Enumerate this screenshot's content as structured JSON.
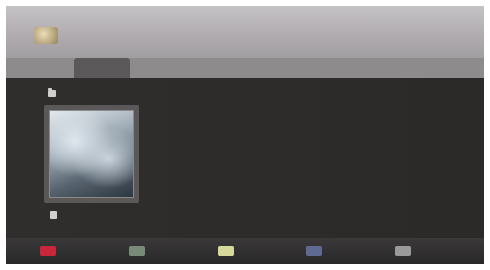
{
  "header": {
    "breadcrumb": [
      "",
      "",
      ""
    ]
  },
  "tabs": [
    {
      "label": "",
      "active": false
    },
    {
      "label": "",
      "active": true
    },
    {
      "label": "",
      "active": false
    },
    {
      "label": "",
      "active": false
    },
    {
      "label": "",
      "active": false
    },
    {
      "label": "",
      "active": false
    }
  ],
  "content": {
    "folder_label": "",
    "item": {
      "caption": ""
    }
  },
  "footer": {
    "keys": [
      {
        "label": "",
        "color": "#c9283a"
      },
      {
        "label": "",
        "color": "#7a8a78"
      },
      {
        "label": "",
        "color": "#d6d99a"
      },
      {
        "label": "",
        "color": "#5f6a92"
      },
      {
        "label": "",
        "color": "#9a9a9a"
      }
    ]
  }
}
